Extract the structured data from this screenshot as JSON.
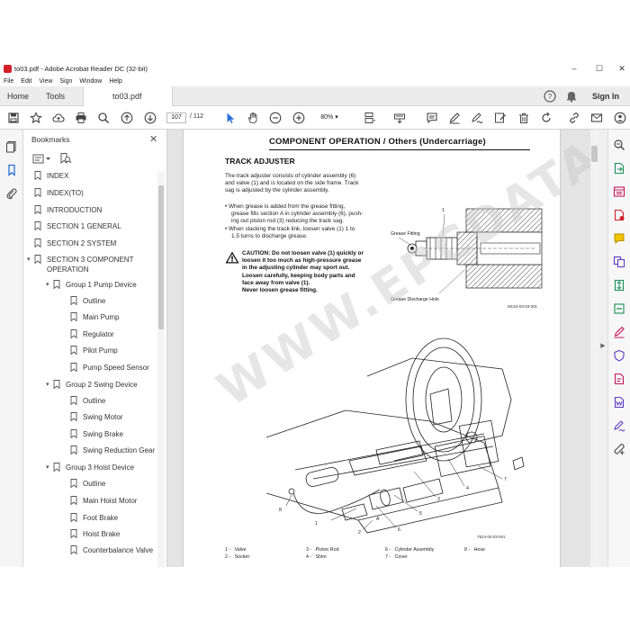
{
  "window": {
    "title": "to03.pdf - Adobe Acrobat Reader DC (32-bit)"
  },
  "menu": [
    "File",
    "Edit",
    "View",
    "Sign",
    "Window",
    "Help"
  ],
  "tabs": {
    "home": "Home",
    "tools": "Tools",
    "document": "to03.pdf"
  },
  "account": {
    "sign_in": "Sign In"
  },
  "toolbar": {
    "page_current": "107",
    "page_total": "/ 112",
    "zoom": "80%"
  },
  "bookmarks": {
    "title": "Bookmarks",
    "items": [
      {
        "label": "INDEX"
      },
      {
        "label": "INDEX(TO)"
      },
      {
        "label": "INTRODUCTION"
      },
      {
        "label": "SECTION 1 GENERAL"
      },
      {
        "label": "SECTION 2 SYSTEM"
      },
      {
        "label": "SECTION 3 COMPONENT OPERATION"
      },
      {
        "label": "Group 1 Pump Device"
      },
      {
        "label": "Outline"
      },
      {
        "label": "Main Pump"
      },
      {
        "label": "Regulator"
      },
      {
        "label": "Pilot Pump"
      },
      {
        "label": "Pump Speed Sensor"
      },
      {
        "label": "Group 2 Swing Device"
      },
      {
        "label": "Outline"
      },
      {
        "label": "Swing Motor"
      },
      {
        "label": "Swing Brake"
      },
      {
        "label": "Swing Reduction Gear"
      },
      {
        "label": "Group 3 Hoist Device"
      },
      {
        "label": "Outline"
      },
      {
        "label": "Main Hoist Motor"
      },
      {
        "label": "Foot Brake"
      },
      {
        "label": "Hoist Brake"
      },
      {
        "label": "Counterbalance Valve"
      }
    ]
  },
  "page": {
    "header": "COMPONENT OPERATION / Others (Undercarriage)",
    "section_title": "TRACK ADJUSTER",
    "intro_lines": [
      "The track adjuster consists of cylinder assembly (6)",
      "and valve (1) and is located on the side frame. Track",
      "sag is adjusted by the cylinder assembly."
    ],
    "bullet_lines": [
      "• When grease is added from the grease fitting,",
      "grease fills section A in cylinder assembly (6), push-",
      "ing out piston rod (3) reducing the track sag.",
      "• When slacking the track link, loosen valve (1) 1 to",
      "1.5 turns to discharge grease."
    ],
    "caution_lines": [
      "CAUTION: Do not loosen valve (1) quickly or",
      "loosen it too much as high-pressure grease",
      "in the adjusting cylinder may sport out.",
      "Loosen carefully, keeping body parts and",
      "face away from valve (1).",
      "Never loosen grease fitting."
    ],
    "diagram1": {
      "callout": "1",
      "grease_fitting": "Grease Fitting",
      "discharge_hole": "Grease Discharge Hole",
      "code": "M1S4-03-03-001"
    },
    "diagram2": {
      "callouts": [
        "1",
        "2",
        "3",
        "4",
        "5",
        "6",
        "7",
        "8",
        "A"
      ],
      "code": "T524-03-03-001"
    },
    "legend": [
      {
        "num": "1 -",
        "name": "Valve"
      },
      {
        "num": "2 -",
        "name": "Socket"
      },
      {
        "num": "3 -",
        "name": "Piston Rod"
      },
      {
        "num": "4 -",
        "name": "Shim"
      },
      {
        "num": "6 -",
        "name": "Cylinder Assembly"
      },
      {
        "num": "7 -",
        "name": "Cover"
      },
      {
        "num": "8 -",
        "name": "Hose"
      }
    ]
  },
  "watermark": "WWW.EPCDATA.COM",
  "colors": {
    "pdf_red": "#d4202a",
    "caution_yellow": "#f2c200",
    "toolbar_blue": "#2d6fd6"
  }
}
